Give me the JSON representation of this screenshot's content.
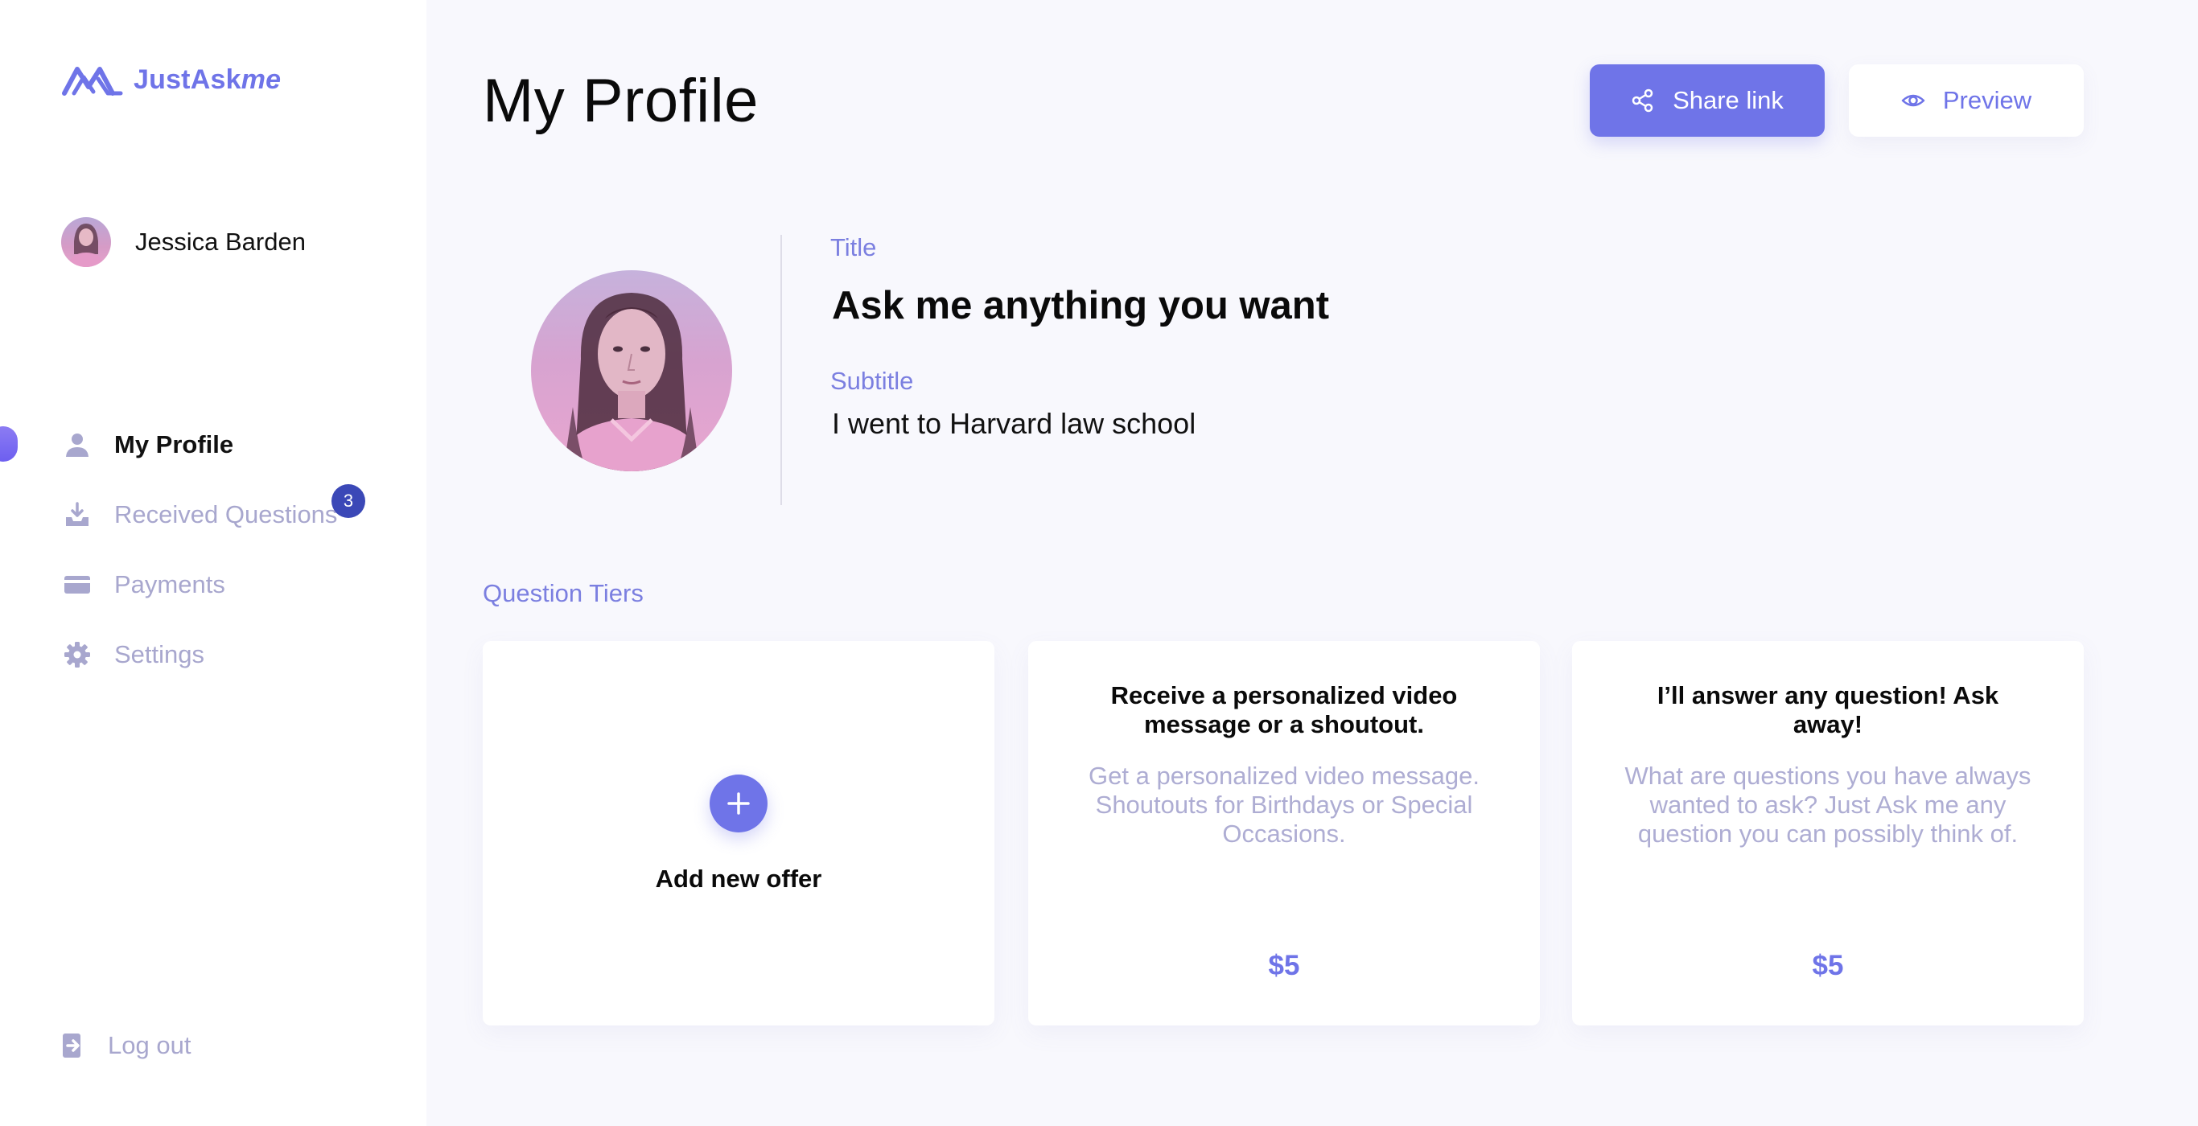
{
  "brand": {
    "name_main": "JustAsk",
    "name_accent": "me",
    "color": "#6f74e8"
  },
  "user": {
    "name": "Jessica Barden"
  },
  "nav": {
    "items": [
      {
        "label": "My Profile",
        "icon": "person-icon",
        "active": true
      },
      {
        "label": "Received Questions",
        "icon": "inbox-download-icon",
        "badge": "3"
      },
      {
        "label": "Payments",
        "icon": "credit-card-icon"
      },
      {
        "label": "Settings",
        "icon": "gear-icon"
      }
    ],
    "logout": "Log out"
  },
  "header": {
    "title": "My Profile",
    "share_label": "Share link",
    "preview_label": "Preview"
  },
  "profile": {
    "title_label": "Title",
    "title_value": "Ask me anything you want",
    "subtitle_label": "Subtitle",
    "subtitle_value": "I went to Harvard law school"
  },
  "tiers": {
    "section_label": "Question Tiers",
    "add_label": "Add new offer",
    "cards": [
      {
        "title": "Receive a personalized video message or a shoutout.",
        "description": "Get a personalized video message. Shoutouts for Birthdays or Special Occasions.",
        "price": "$5"
      },
      {
        "title": "I’ll answer any question! Ask away!",
        "description": "What are questions you have always wanted to ask? Just Ask me any question you can possibly think of.",
        "price": "$5"
      }
    ]
  },
  "colors": {
    "accent": "#6f74e8",
    "muted": "#a8a7ce",
    "badge": "#3b48b7",
    "background": "#f8f8fd"
  }
}
